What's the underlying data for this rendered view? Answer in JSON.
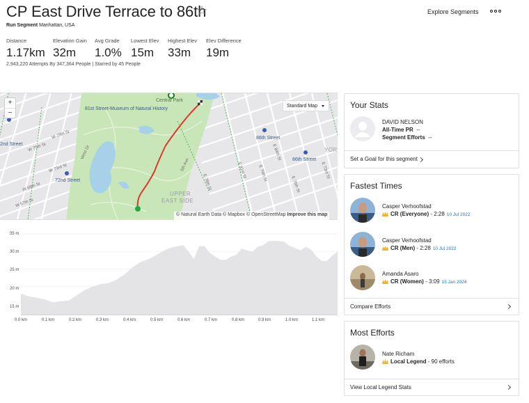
{
  "header": {
    "title": "CP East Drive Terrace to 86th",
    "star_icon": "☆",
    "explore_label": "Explore Segments",
    "more_icon": "more-dots-icon",
    "type_label": "Run Segment",
    "location": "Manhattan, USA",
    "attempts": "2,943,220 Attempts By 347,364 People | Starred by 45 People"
  },
  "stats": [
    {
      "label": "Distance",
      "value": "1.17km"
    },
    {
      "label": "Elevation Gain",
      "value": "32m"
    },
    {
      "label": "Avg Grade",
      "value": "1.0%"
    },
    {
      "label": "Lowest Elev",
      "value": "15m"
    },
    {
      "label": "Highest Elev",
      "value": "33m"
    },
    {
      "label": "Elev Difference",
      "value": "19m"
    }
  ],
  "map": {
    "zoom_in": "+",
    "zoom_out": "−",
    "style_select": "Standard Map",
    "attribution": "© Natural Earth Data © Mapbox © OpenStreetMap",
    "improve": "Improve this map",
    "labels": {
      "central_park": "Central Park",
      "museum": "81st Street-Museum of Natural History",
      "museum_line2": "of Natural History",
      "w79": "W 79th St",
      "w75": "W 75th St",
      "w73": "W 73rd St",
      "w69": "W 69th St",
      "w67": "W 67th St",
      "second": "2nd Street",
      "seventy_second": "72nd Street",
      "eighty_sixth_a": "86th Street",
      "eighty_sixth_b": "86th Street",
      "e84": "E 84th St",
      "e81": "E 81st St",
      "e79": "E 79th St",
      "e76": "E 76th St",
      "e73": "E 73rd St",
      "e78": "E 78th St",
      "fifth": "5th Ave",
      "west_dr": "West Dr",
      "ues1": "UPPER",
      "ues2": "EAST SIDE",
      "york": "YOR"
    },
    "colors": {
      "park": "#c9e6b8",
      "water": "#a7d1e8",
      "route": "#e0362c",
      "street": "#ffffff",
      "green_line": "#4caf50"
    }
  },
  "elevation": {
    "y_ticks": [
      "35 m",
      "30 m",
      "25 m",
      "20 m",
      "15 m"
    ],
    "x_ticks": [
      "0.0 km",
      "0.1 km",
      "0.2 km",
      "0.3 km",
      "0.4 km",
      "0.5 km",
      "0.6 km",
      "0.7 km",
      "0.8 km",
      "0.9 km",
      "1.0 km",
      "1.1 km"
    ]
  },
  "chart_data": {
    "type": "area",
    "xlabel": "",
    "ylabel": "",
    "xlim": [
      0,
      1.19
    ],
    "ylim": [
      12,
      36
    ],
    "x": [
      0.0,
      0.03,
      0.06,
      0.09,
      0.12,
      0.15,
      0.18,
      0.21,
      0.24,
      0.27,
      0.3,
      0.33,
      0.36,
      0.39,
      0.42,
      0.45,
      0.48,
      0.5,
      0.53,
      0.55,
      0.57,
      0.59,
      0.61,
      0.63,
      0.65,
      0.67,
      0.69,
      0.71,
      0.73,
      0.75,
      0.77,
      0.79,
      0.81,
      0.83,
      0.85,
      0.87,
      0.89,
      0.91,
      0.93,
      0.95,
      0.97,
      0.99,
      1.01,
      1.03,
      1.05,
      1.07,
      1.09,
      1.11,
      1.13,
      1.15,
      1.17,
      1.19
    ],
    "y": [
      18.0,
      17.2,
      16.8,
      16.3,
      15.5,
      15.8,
      16.0,
      17.5,
      19.0,
      20.0,
      20.7,
      21.0,
      22.0,
      23.5,
      25.5,
      27.0,
      27.8,
      28.6,
      29.9,
      30.7,
      31.2,
      31.5,
      31.8,
      30.0,
      27.8,
      31.5,
      31.5,
      29.6,
      28.5,
      27.6,
      27.6,
      28.5,
      29.1,
      30.8,
      30.3,
      30.0,
      31.3,
      31.8,
      32.9,
      33.0,
      33.0,
      32.7,
      31.6,
      31.0,
      30.3,
      31.3,
      30.6,
      28.6,
      27.3,
      27.3,
      28.8,
      30.0
    ],
    "series": [
      {
        "values": []
      }
    ]
  },
  "your_stats": {
    "title": "Your Stats",
    "name": "DAVID NELSON",
    "pr_label": "All-Time PR",
    "pr_value": "--",
    "efforts_label": "Segment Efforts",
    "efforts_value": "--",
    "goal_link": "Set a Goal for this segment"
  },
  "fastest": {
    "title": "Fastest Times",
    "entries": [
      {
        "name": "Casper Verhoofstad",
        "category": "CR (Everyone)",
        "time": "- 2:28",
        "date": "10 Jul 2022"
      },
      {
        "name": "Casper Verhoofstad",
        "category": "CR (Men)",
        "time": "- 2:28",
        "date": "10 Jul 2022"
      },
      {
        "name": "Amanda Asaro",
        "category": "CR (Women)",
        "time": "- 3:09",
        "date": "15 Jan 2024"
      }
    ],
    "compare_link": "Compare Efforts"
  },
  "most_efforts": {
    "title": "Most Efforts",
    "name": "Nate Richam",
    "legend": "Local Legend",
    "count": "- 90 efforts",
    "link": "View Local Legend Stats"
  }
}
